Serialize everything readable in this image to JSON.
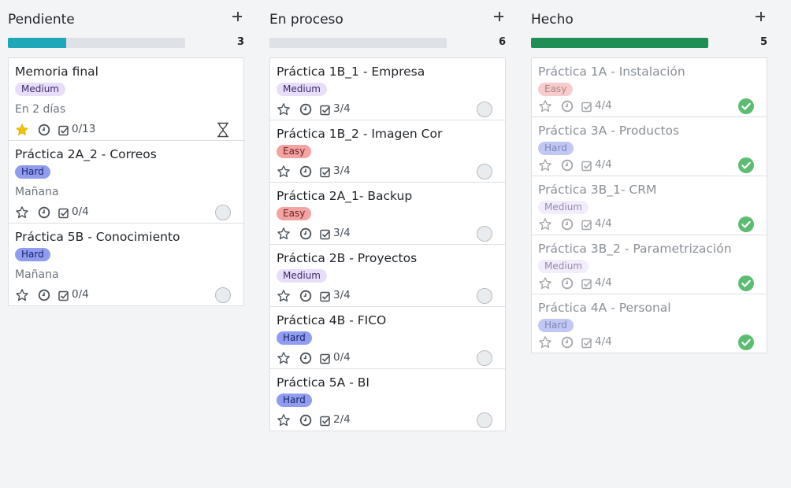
{
  "colors": {
    "pendiente_bar": "#1ea7b8",
    "proceso_bar": "#dee1e5",
    "hecho_bar": "#1f8f55",
    "done_check": "#5cbd72",
    "star_active": "#f2c300"
  },
  "columns": [
    {
      "title": "Pendiente",
      "count": "3",
      "progress": 0.33,
      "bar_color": "#1ea7b8",
      "cards": [
        {
          "name": "Memoria final",
          "tag": "Medium",
          "tag_class": "medium",
          "due": "En 2 días",
          "count": "0/13",
          "starred": true,
          "status": "hourglass-icon"
        },
        {
          "name": "Práctica 2A_2 - Correos",
          "tag": "Hard",
          "tag_class": "hard",
          "due": "Mañana",
          "count": "0/4",
          "starred": false,
          "status": "empty"
        },
        {
          "name": "Práctica 5B - Conocimiento",
          "tag": "Hard",
          "tag_class": "hard",
          "due": "Mañana",
          "count": "0/4",
          "starred": false,
          "status": "empty"
        }
      ]
    },
    {
      "title": "En proceso",
      "count": "6",
      "progress": 0,
      "bar_color": "#dee1e5",
      "cards": [
        {
          "name": "Práctica 1B_1 - Empresa",
          "tag": "Medium",
          "tag_class": "medium",
          "count": "3/4",
          "starred": false,
          "status": "empty"
        },
        {
          "name": "Práctica 1B_2 - Imagen Cor",
          "tag": "Easy",
          "tag_class": "easy",
          "count": "3/4",
          "starred": false,
          "status": "empty"
        },
        {
          "name": "Práctica 2A_1- Backup",
          "tag": "Easy",
          "tag_class": "easy",
          "count": "3/4",
          "starred": false,
          "status": "empty"
        },
        {
          "name": "Práctica 2B - Proyectos",
          "tag": "Medium",
          "tag_class": "medium",
          "count": "3/4",
          "starred": false,
          "status": "empty"
        },
        {
          "name": "Práctica 4B - FICO",
          "tag": "Hard",
          "tag_class": "hard",
          "count": "0/4",
          "starred": false,
          "status": "empty"
        },
        {
          "name": "Práctica 5A - BI",
          "tag": "Hard",
          "tag_class": "hard",
          "count": "2/4",
          "starred": false,
          "status": "empty"
        }
      ]
    },
    {
      "title": "Hecho",
      "count": "5",
      "progress": 1,
      "bar_color": "#1f8f55",
      "cards": [
        {
          "name": "Práctica 1A - Instalación",
          "tag": "Easy",
          "tag_class": "easy",
          "count": "4/4",
          "starred": false,
          "status": "done"
        },
        {
          "name": "Práctica 3A - Productos",
          "tag": "Hard",
          "tag_class": "hard",
          "count": "4/4",
          "starred": false,
          "status": "done"
        },
        {
          "name": "Práctica 3B_1- CRM",
          "tag": "Medium",
          "tag_class": "medium",
          "count": "4/4",
          "starred": false,
          "status": "done"
        },
        {
          "name": "Práctica 3B_2 - Parametrización",
          "tag": "Medium",
          "tag_class": "medium",
          "count": "4/4",
          "starred": false,
          "status": "done"
        },
        {
          "name": "Práctica 4A - Personal",
          "tag": "Hard",
          "tag_class": "hard",
          "count": "4/4",
          "starred": false,
          "status": "done"
        }
      ]
    }
  ]
}
